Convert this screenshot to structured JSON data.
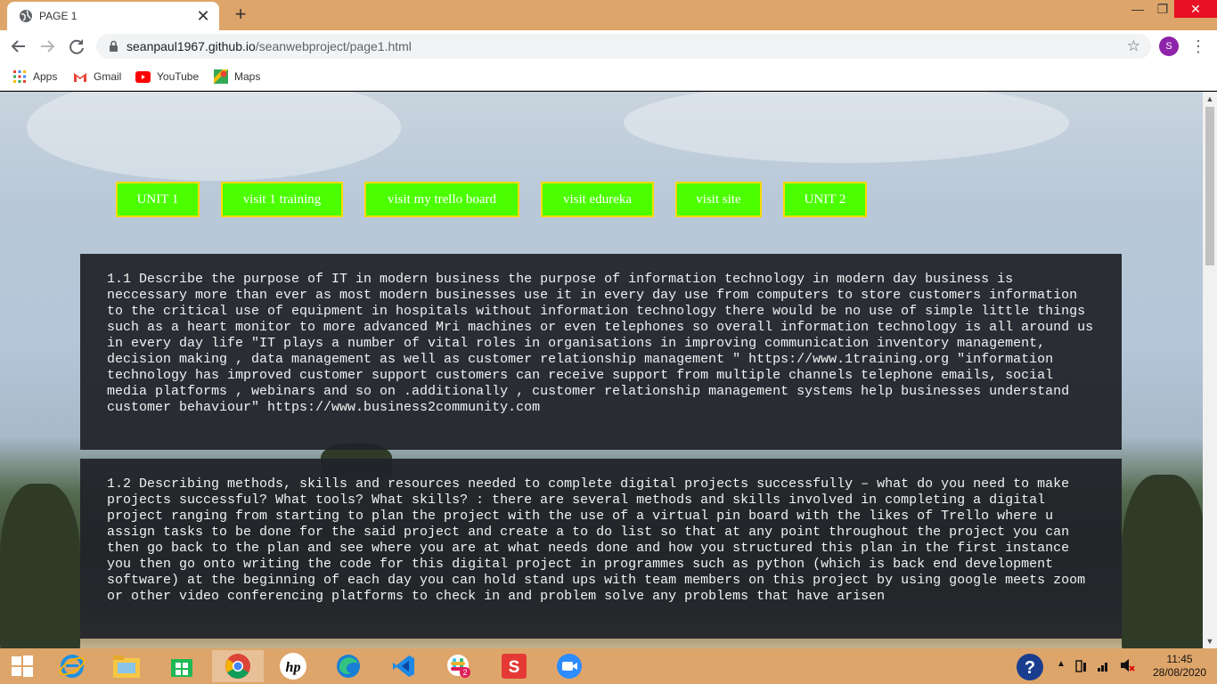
{
  "browser": {
    "tab_title": "PAGE 1",
    "url_host": "seanpaul1967.github.io",
    "url_path": "/seanwebproject/page1.html",
    "profile_initial": "S",
    "bookmarks": [
      "Apps",
      "Gmail",
      "YouTube",
      "Maps"
    ]
  },
  "nav": {
    "buttons": [
      "UNIT 1",
      "visit 1 training",
      "visit my trello board",
      "visit edureka",
      "visit site",
      "UNIT 2"
    ]
  },
  "content": {
    "section1": "1.1 Describe the purpose of IT in modern business the purpose of information technology in modern day business is neccessary more than ever as most modern businesses use it in every day use from computers to store customers information to the critical use of equipment in hospitals without information technology there would be no use of simple little things such as a heart monitor to more advanced Mri machines or even telephones so overall information technology is all around us in every day life \"IT plays a number of vital roles in organisations in improving communication inventory management, decision making , data management as well as customer relationship management \" https://www.1training.org \"information technology has improved customer support customers can receive support from multiple channels telephone emails, social media platforms , webinars and so on .additionally , customer relationship management systems help businesses understand customer behaviour\" https://www.business2community.com",
    "section2": "1.2 Describing methods, skills and resources needed to complete digital projects successfully – what do you need to make projects successful? What tools? What skills? : there are several methods and skills involved in completing a digital project ranging from starting to plan the project with the use of a virtual pin board with the likes of Trello where u assign tasks to be done for the said project and create a to do list so that at any point throughout the project you can then go back to the plan and see where you are at what needs done and how you structured this plan in the first instance you then go onto writing the code for this digital project in programmes such as python (which is back end development software) at the beginning of each day you can hold stand ups with team members on this project by using google meets zoom or other video conferencing platforms to check in and problem solve any problems that have arisen"
  },
  "taskbar": {
    "time": "11:45",
    "date": "28/08/2020",
    "slack_badge": "2"
  },
  "colors": {
    "nav_button_bg": "#4cff00",
    "nav_button_border": "#ffd900",
    "textbox_bg": "#212328",
    "chrome_accent": "#dea56a"
  }
}
